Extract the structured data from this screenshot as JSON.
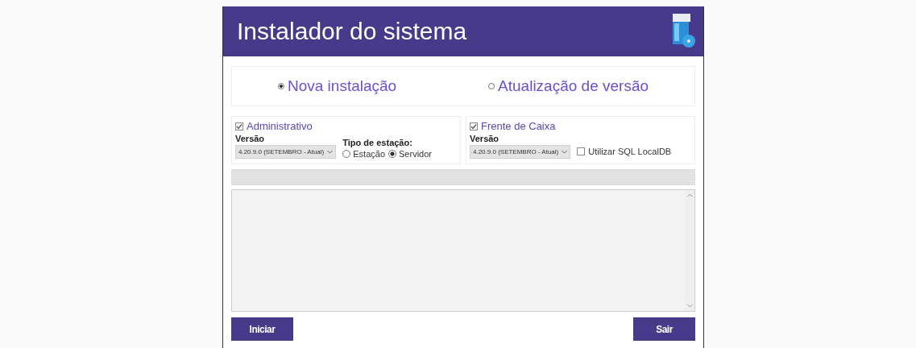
{
  "window": {
    "title": "Instalador do sistema"
  },
  "mode_options": [
    {
      "label": "Nova instalação",
      "selected": true
    },
    {
      "label": "Atualização de versão",
      "selected": false
    }
  ],
  "panels": [
    {
      "title": "Administrativo",
      "checked": true,
      "version_label": "Versão",
      "version": "4.20.9.0 (SETEMBRO - Atual)",
      "station_type": {
        "label": "Tipo de estação:",
        "options": [
          {
            "label": "Estação",
            "selected": false
          },
          {
            "label": "Servidor",
            "selected": true
          }
        ]
      }
    },
    {
      "title": "Frente de Caixa",
      "checked": true,
      "version_label": "Versão",
      "version": "4.20.9.0 (SETEMBRO - Atual)",
      "option": {
        "label": "Utilizar SQL LocalDB",
        "checked": false
      }
    }
  ],
  "progress": {
    "level": 0
  },
  "buttons": [
    {
      "label": "Iniciar"
    },
    {
      "label": "Sair"
    }
  ]
}
